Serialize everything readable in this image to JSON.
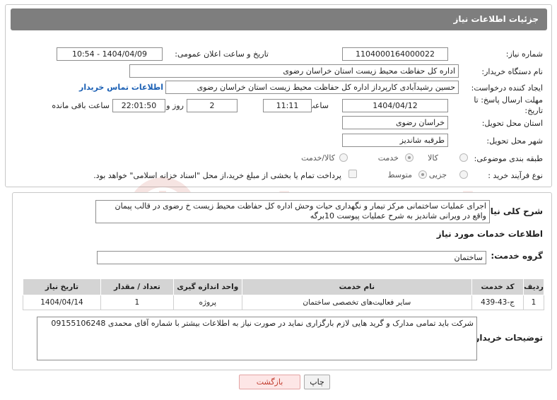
{
  "panel_title": "جزئیات اطلاعات نیاز",
  "need_number": {
    "label": "شماره نیاز:",
    "value": "1104000164000022"
  },
  "announce_datetime": {
    "label": "تاریخ و ساعت اعلان عمومی:",
    "value": "1404/04/09 - 10:54"
  },
  "buyer_org": {
    "label": "نام دستگاه خریدار:",
    "value": "اداره کل حفاظت محیط زیست استان خراسان رضوی"
  },
  "requester": {
    "label": "ایجاد کننده درخواست:",
    "value": "حسین رشیدآبادی کارپرداز اداره کل حفاظت محیط زیست استان خراسان رضوی",
    "contact_link": "اطلاعات تماس خریدار"
  },
  "deadline": {
    "label": "مهلت ارسال پاسخ: تا تاریخ:",
    "date": "1404/04/12",
    "time_label": "ساعت",
    "time": "11:11",
    "days": "2",
    "days_label": "روز و",
    "remaining": "22:01:50",
    "remaining_label": "ساعت باقی مانده"
  },
  "delivery_province": {
    "label": "استان محل تحویل:",
    "value": "خراسان رضوی"
  },
  "delivery_city": {
    "label": "شهر محل تحویل:",
    "value": "طرقبه شاندیز"
  },
  "category": {
    "label": "طبقه بندی موضوعی:",
    "options": [
      "کالا",
      "خدمت",
      "کالا/خدمت"
    ],
    "selected": "خدمت"
  },
  "purchase_type": {
    "label": "نوع فرآیند خرید :",
    "options": [
      "جزیی",
      "متوسط"
    ],
    "selected": "متوسط",
    "payment_note": "پرداخت تمام یا بخشی از مبلغ خرید،از محل \"اسناد خزانه اسلامی\" خواهد بود."
  },
  "summary": {
    "label": "شرح کلی نیاز:",
    "value": "اجرای عملیات ساختمانی مرکز تیمار و نگهداری حیات وحش اداره کل حفاظت محیط زیست خ رضوی در قالب پیمان واقع در ویرانی شاندیز به شرح عملیات پیوست 10برگه"
  },
  "services_heading": "اطلاعات خدمات مورد نیاز",
  "service_group": {
    "label": "گروه خدمت:",
    "value": "ساختمان"
  },
  "table": {
    "headers": [
      "ردیف",
      "کد خدمت",
      "نام خدمت",
      "واحد اندازه گیری",
      "تعداد / مقدار",
      "تاریخ نیاز"
    ],
    "rows": [
      [
        "1",
        "ج-43-439",
        "سایر فعالیت‌های تخصصی ساختمان",
        "پروژه",
        "1",
        "1404/04/14"
      ]
    ]
  },
  "buyer_notes": {
    "label": "توضیحات خریدار:",
    "value": "شرکت باید تمامی مدارک و گرید هایی لازم بارگزاری نماید در صورت نیاز به اطلاعات بیشتر با شماره آقای محمدی 09155106248"
  },
  "buttons": {
    "print": "چاپ",
    "back": "بازگشت"
  },
  "watermark_text": "AriaTender.neT"
}
